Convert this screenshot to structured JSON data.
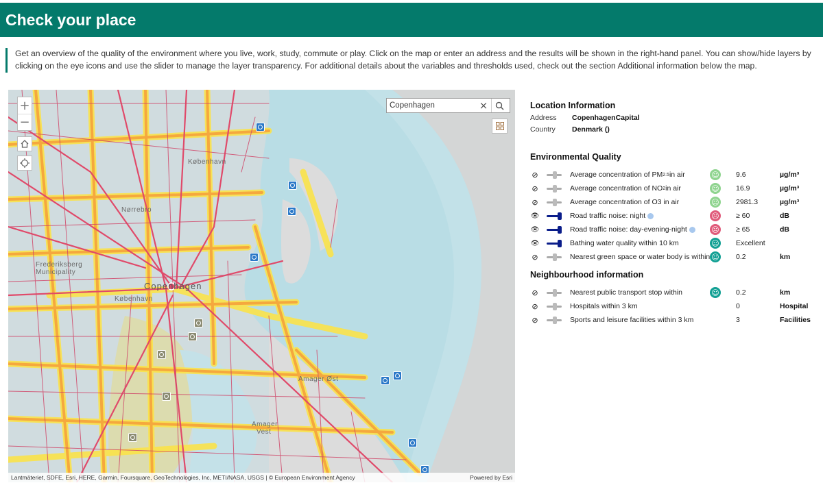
{
  "page": {
    "title": "Check your place",
    "intro_line1": "Get an overview of the quality of the environment where you live, work, study, commute or play. Click on the map or enter an address and the results will be shown in the right-hand panel. You can show/hide layers by",
    "intro_line2": "clicking on the eye icons and use the slider to manage the layer transparency. For additional details about the variables and thresholds used, check out the section Additional information below the map."
  },
  "map": {
    "search_value": "Copenhagen",
    "zoom_in": "+",
    "zoom_out": "−",
    "labels": {
      "kobenhavn_north": "København",
      "norrebro": "Nørrebro",
      "frederiksberg": "Frederiksberg",
      "municipality": "Municipality",
      "copenhagen": "Copenhagen",
      "kobenhavn_center": "København",
      "amager_ost": "Amager Øst",
      "amager": "Amager",
      "vest": "Vest"
    },
    "attribution": "Lantmäteriet, SDFE, Esri, HERE, Garmin, Foursquare, GeoTechnologies, Inc, METI/NASA, USGS | © European Environment Agency",
    "powered_by": "Powered by Esri"
  },
  "location": {
    "title": "Location Information",
    "address_label": "Address",
    "address_value": "CopenhagenCapital",
    "country_label": "Country",
    "country_value": "Denmark ()"
  },
  "environmental": {
    "title": "Environmental Quality",
    "rows": [
      {
        "label": "Average concentration of PM",
        "sub": "2.5",
        "label_tail": " in air",
        "face": "happy",
        "face_color": "#8fd48f",
        "value": "9.6",
        "unit": "µg/m³",
        "visible": false
      },
      {
        "label": "Average concentration of NO",
        "sub": "2",
        "label_tail": " in air",
        "face": "happy",
        "face_color": "#8fd48f",
        "value": "16.9",
        "unit": "µg/m³",
        "visible": false
      },
      {
        "label": "Average concentration of O3 in air",
        "sub": "",
        "label_tail": "",
        "face": "happy",
        "face_color": "#8fd48f",
        "value": "2981.3",
        "unit": "µg/m³",
        "visible": false
      },
      {
        "label": "Road traffic noise: night",
        "sub": "",
        "label_tail": "",
        "face": "sad",
        "face_color": "#e05a7a",
        "value": "≥ 60",
        "unit": "dB",
        "visible": true
      },
      {
        "label": "Road traffic noise: day-evening-night",
        "sub": "",
        "label_tail": "",
        "face": "sad",
        "face_color": "#e05a7a",
        "value": "≥ 65",
        "unit": "dB",
        "visible": true
      },
      {
        "label": "Bathing water quality within 10 km",
        "sub": "",
        "label_tail": "",
        "face": "happy",
        "face_color": "#12a094",
        "value": "Excellent",
        "unit": "",
        "visible": true
      },
      {
        "label": "Nearest green space or water body is within",
        "sub": "",
        "label_tail": "",
        "face": "happy",
        "face_color": "#12a094",
        "value": "0.2",
        "unit": "km",
        "visible": false
      }
    ]
  },
  "neighbourhood": {
    "title": "Neighbourhood information",
    "rows": [
      {
        "label": "Nearest public transport stop within",
        "face": "happy",
        "face_color": "#12a094",
        "value": "0.2",
        "unit": "km"
      },
      {
        "label": "Hospitals within 3 km",
        "face": "",
        "face_color": "",
        "value": "0",
        "unit": "Hospital"
      },
      {
        "label": "Sports and leisure facilities within 3 km",
        "face": "",
        "face_color": "",
        "value": "3",
        "unit": "Facilities"
      }
    ]
  },
  "colors": {
    "header": "#047a6b",
    "water": "#b9dde5",
    "land": "#d9d9d9",
    "noise_low": "#fbe34a",
    "noise_mid": "#f5a23c",
    "noise_high": "#e04a6a"
  },
  "icons": {
    "hidden": "eye-slash-icon",
    "shown": "eye-icon",
    "poi": "bathing-site-icon"
  }
}
